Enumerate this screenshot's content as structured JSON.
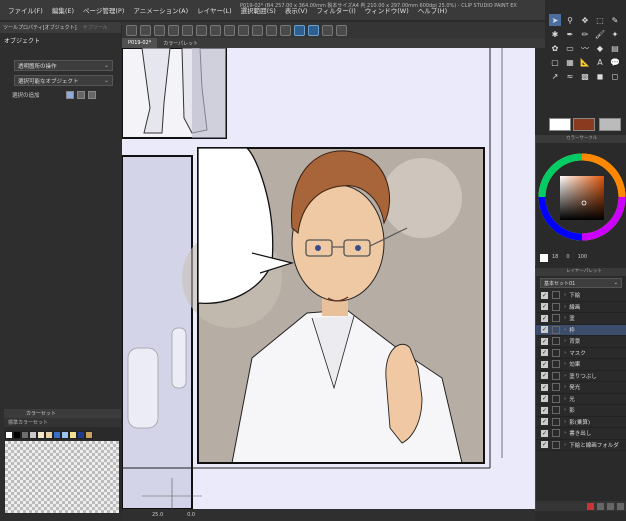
{
  "app": {
    "title": "P019-02* (B4 257.00 x 364.00mm 製本サイズA4 判 210.00 x 297.00mm 600dpi 25.0%) - CLIP STUDIO PAINT EX"
  },
  "menu": [
    "ファイル(F)",
    "編集(E)",
    "ページ管理(P)",
    "アニメーション(A)",
    "レイヤー(L)",
    "選択範囲(S)",
    "表示(V)",
    "フィルター(I)",
    "ウィンドウ(W)",
    "ヘルプ(H)"
  ],
  "left_panel": {
    "tabs": [
      "ツールプロパティ[オブジェクト]",
      "サブツール"
    ],
    "title": "オブジェクト",
    "dropdown1": "透明箇所の操作",
    "dropdown2": "選択可能なオブジェクト",
    "add_selection_label": "選択の追加"
  },
  "color_set": {
    "tab_label": "カラーセット",
    "selected": "標準カラーセット",
    "swatches": [
      "#ffffff",
      "#000000",
      "#6e6e6e",
      "#c8c8c8",
      "#f2e6c8",
      "#e8d2a8",
      "#3c6ec8",
      "#9cc4f0",
      "#f0e090",
      "#1e3c8c",
      "#c8a060"
    ]
  },
  "canvas": {
    "tabs": [
      "P019-02*",
      "カラーパレット"
    ],
    "footer": {
      "zoom": "25.0",
      "angle": "0.0"
    }
  },
  "color_wheel": {
    "header": "カラーサークル",
    "values": [
      "18",
      "0",
      "100"
    ]
  },
  "layers": {
    "header": "レイヤーパレット",
    "set": "基本セット01",
    "items": [
      {
        "name": "下絵",
        "selected": false
      },
      {
        "name": "線画",
        "selected": false
      },
      {
        "name": "塗",
        "selected": false
      },
      {
        "name": "枠",
        "selected": true
      },
      {
        "name": "背景",
        "selected": false
      },
      {
        "name": "マスク",
        "selected": false
      },
      {
        "name": "効果",
        "selected": false
      },
      {
        "name": "塗りつぶし",
        "selected": false
      },
      {
        "name": "発光",
        "selected": false
      },
      {
        "name": "光",
        "selected": false
      },
      {
        "name": "影",
        "selected": false
      },
      {
        "name": "影(乗算)",
        "selected": false
      },
      {
        "name": "書き出し",
        "selected": false
      },
      {
        "name": "下絵と線画フォルダ",
        "selected": false
      }
    ]
  },
  "colors": {
    "fg": "#ffffff",
    "bg": "#8a3a1e",
    "accent": "#4a6ea0"
  }
}
